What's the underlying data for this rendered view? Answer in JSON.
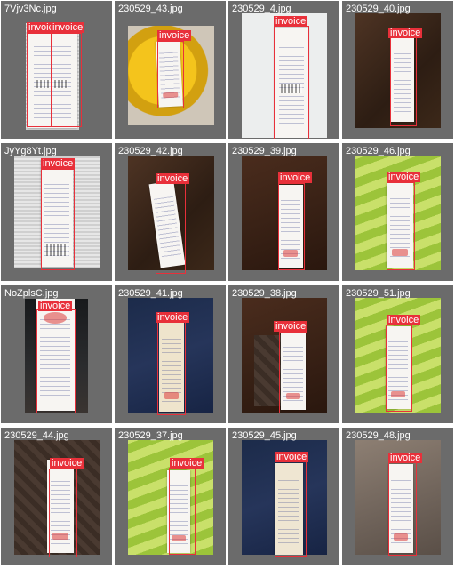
{
  "gallery": {
    "label_text": "invoice",
    "tiles": [
      {
        "filename": "7Vjv3Nc.jpg",
        "labels": [
          "invoice",
          "invoice"
        ]
      },
      {
        "filename": "230529_43.jpg",
        "labels": [
          "invoice"
        ]
      },
      {
        "filename": "230529_4.jpg",
        "labels": [
          "invoice"
        ]
      },
      {
        "filename": "230529_40.jpg",
        "labels": [
          "invoice"
        ]
      },
      {
        "filename": "JyYg8Yt.jpg",
        "labels": [
          "invoice"
        ]
      },
      {
        "filename": "230529_42.jpg",
        "labels": [
          "invoice"
        ]
      },
      {
        "filename": "230529_39.jpg",
        "labels": [
          "invoice"
        ]
      },
      {
        "filename": "230529_46.jpg",
        "labels": [
          "invoice"
        ]
      },
      {
        "filename": "NoZplsC.jpg",
        "labels": [
          "invoice"
        ]
      },
      {
        "filename": "230529_41.jpg",
        "labels": [
          "invoice"
        ]
      },
      {
        "filename": "230529_38.jpg",
        "labels": [
          "invoice"
        ]
      },
      {
        "filename": "230529_51.jpg",
        "labels": [
          "invoice"
        ]
      },
      {
        "filename": "230529_44.jpg",
        "labels": [
          "invoice"
        ]
      },
      {
        "filename": "230529_37.jpg",
        "labels": [
          "invoice"
        ]
      },
      {
        "filename": "230529_45.jpg",
        "labels": [
          "invoice"
        ]
      },
      {
        "filename": "230529_48.jpg",
        "labels": [
          "invoice"
        ]
      }
    ]
  },
  "colors": {
    "tile_bg": "#6b6b6b",
    "label_red": "#e8303a",
    "label_text": "#ffffff"
  }
}
